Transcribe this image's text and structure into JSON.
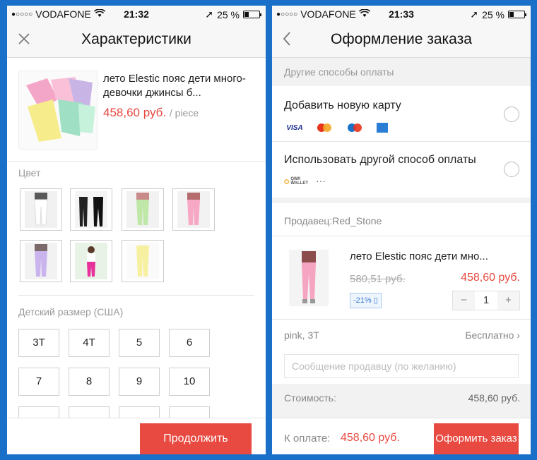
{
  "status": {
    "carrier": "VODAFONE",
    "battery": "25 %",
    "time_left": "21:32",
    "time_right": "21:33"
  },
  "left": {
    "title": "Характеристики",
    "product": {
      "title": "лето Elestic пояс дети много-девочки джинсы б...",
      "price": "458,60 руб.",
      "unit": "/ piece"
    },
    "color_label": "Цвет",
    "size_label": "Детский размер (США)",
    "sizes": [
      "3T",
      "4T",
      "5",
      "6",
      "7",
      "8",
      "9",
      "10"
    ],
    "continue_label": "Продолжить"
  },
  "right": {
    "title": "Оформление заказа",
    "other_payment_label": "Другие способы оплаты",
    "add_card_label": "Добавить новую карту",
    "card_logos": [
      "VISA",
      "MC",
      "Maestro",
      "AmEx"
    ],
    "other_method_label": "Использовать другой способ оплаты",
    "qiwi_label": "QIWI WALLET",
    "more_label": "···",
    "seller_label": "Продавец:Red_Stone",
    "order": {
      "title": "лето Elestic пояс дети мно...",
      "old_price": "580,51 руб.",
      "new_price": "458,60 руб.",
      "discount": "-21%",
      "quantity": "1",
      "minus": "−",
      "plus": "+",
      "variant": "pink, 3T",
      "shipping": "Бесплатно ›"
    },
    "message_placeholder": "Сообщение продавцу (по желанию)",
    "cost_label": "Стоимость:",
    "cost_value": "458,60 руб.",
    "total_label": "К оплате:",
    "total_value": "458,60 руб.",
    "checkout_label": "Оформить заказ"
  },
  "colors": {
    "accent": "#e84940",
    "frame": "#1a6fc9"
  }
}
